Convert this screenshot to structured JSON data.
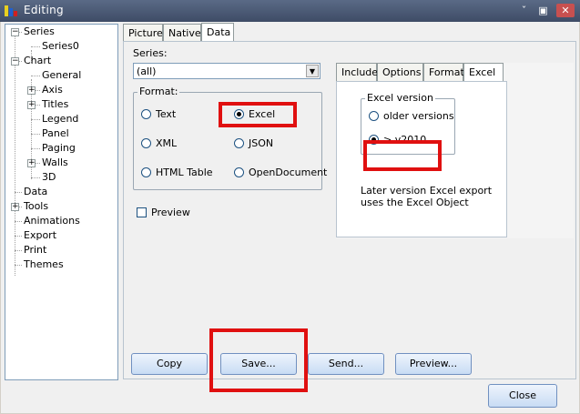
{
  "window": {
    "title": "Editing",
    "minimize_glyph": "ˇ",
    "restore_glyph": "▣",
    "close_glyph": "✕"
  },
  "tree": {
    "items": [
      {
        "label": "Series",
        "expander": "−"
      },
      {
        "label": "Series0"
      },
      {
        "label": "Chart",
        "expander": "−"
      },
      {
        "label": "General"
      },
      {
        "label": "Axis",
        "expander": "+"
      },
      {
        "label": "Titles",
        "expander": "+"
      },
      {
        "label": "Legend"
      },
      {
        "label": "Panel"
      },
      {
        "label": "Paging"
      },
      {
        "label": "Walls",
        "expander": "+"
      },
      {
        "label": "3D"
      },
      {
        "label": "Data"
      },
      {
        "label": "Tools",
        "expander": "+"
      },
      {
        "label": "Animations"
      },
      {
        "label": "Export",
        "selected": true
      },
      {
        "label": "Print"
      },
      {
        "label": "Themes"
      }
    ]
  },
  "tabs": [
    "Picture",
    "Native",
    "Data"
  ],
  "active_tab": "Data",
  "series": {
    "label": "Series:",
    "value": "(all)",
    "arrow": "▼"
  },
  "format": {
    "label": "Format:",
    "options": [
      {
        "label": "Text",
        "checked": false
      },
      {
        "label": "Excel",
        "checked": true
      },
      {
        "label": "XML",
        "checked": false
      },
      {
        "label": "JSON",
        "checked": false
      },
      {
        "label": "HTML Table",
        "checked": false
      },
      {
        "label": "OpenDocument",
        "checked": false
      }
    ]
  },
  "preview_checkbox": {
    "label": "Preview",
    "checked": false
  },
  "sub_tabs": [
    "Include",
    "Options",
    "Format",
    "Excel"
  ],
  "active_sub_tab": "Excel",
  "excel_version": {
    "label": "Excel version",
    "options": [
      {
        "label": "older versions",
        "checked": false
      },
      {
        "label": "> v2010",
        "checked": true
      }
    ],
    "note_line1": "Later version Excel export",
    "note_line2": "uses the Excel Object"
  },
  "buttons": {
    "copy": "Copy",
    "save": "Save...",
    "send": "Send...",
    "preview": "Preview...",
    "close": "Close"
  },
  "colors": {
    "highlight": "#e01010",
    "title_bar": "#4a5874"
  }
}
